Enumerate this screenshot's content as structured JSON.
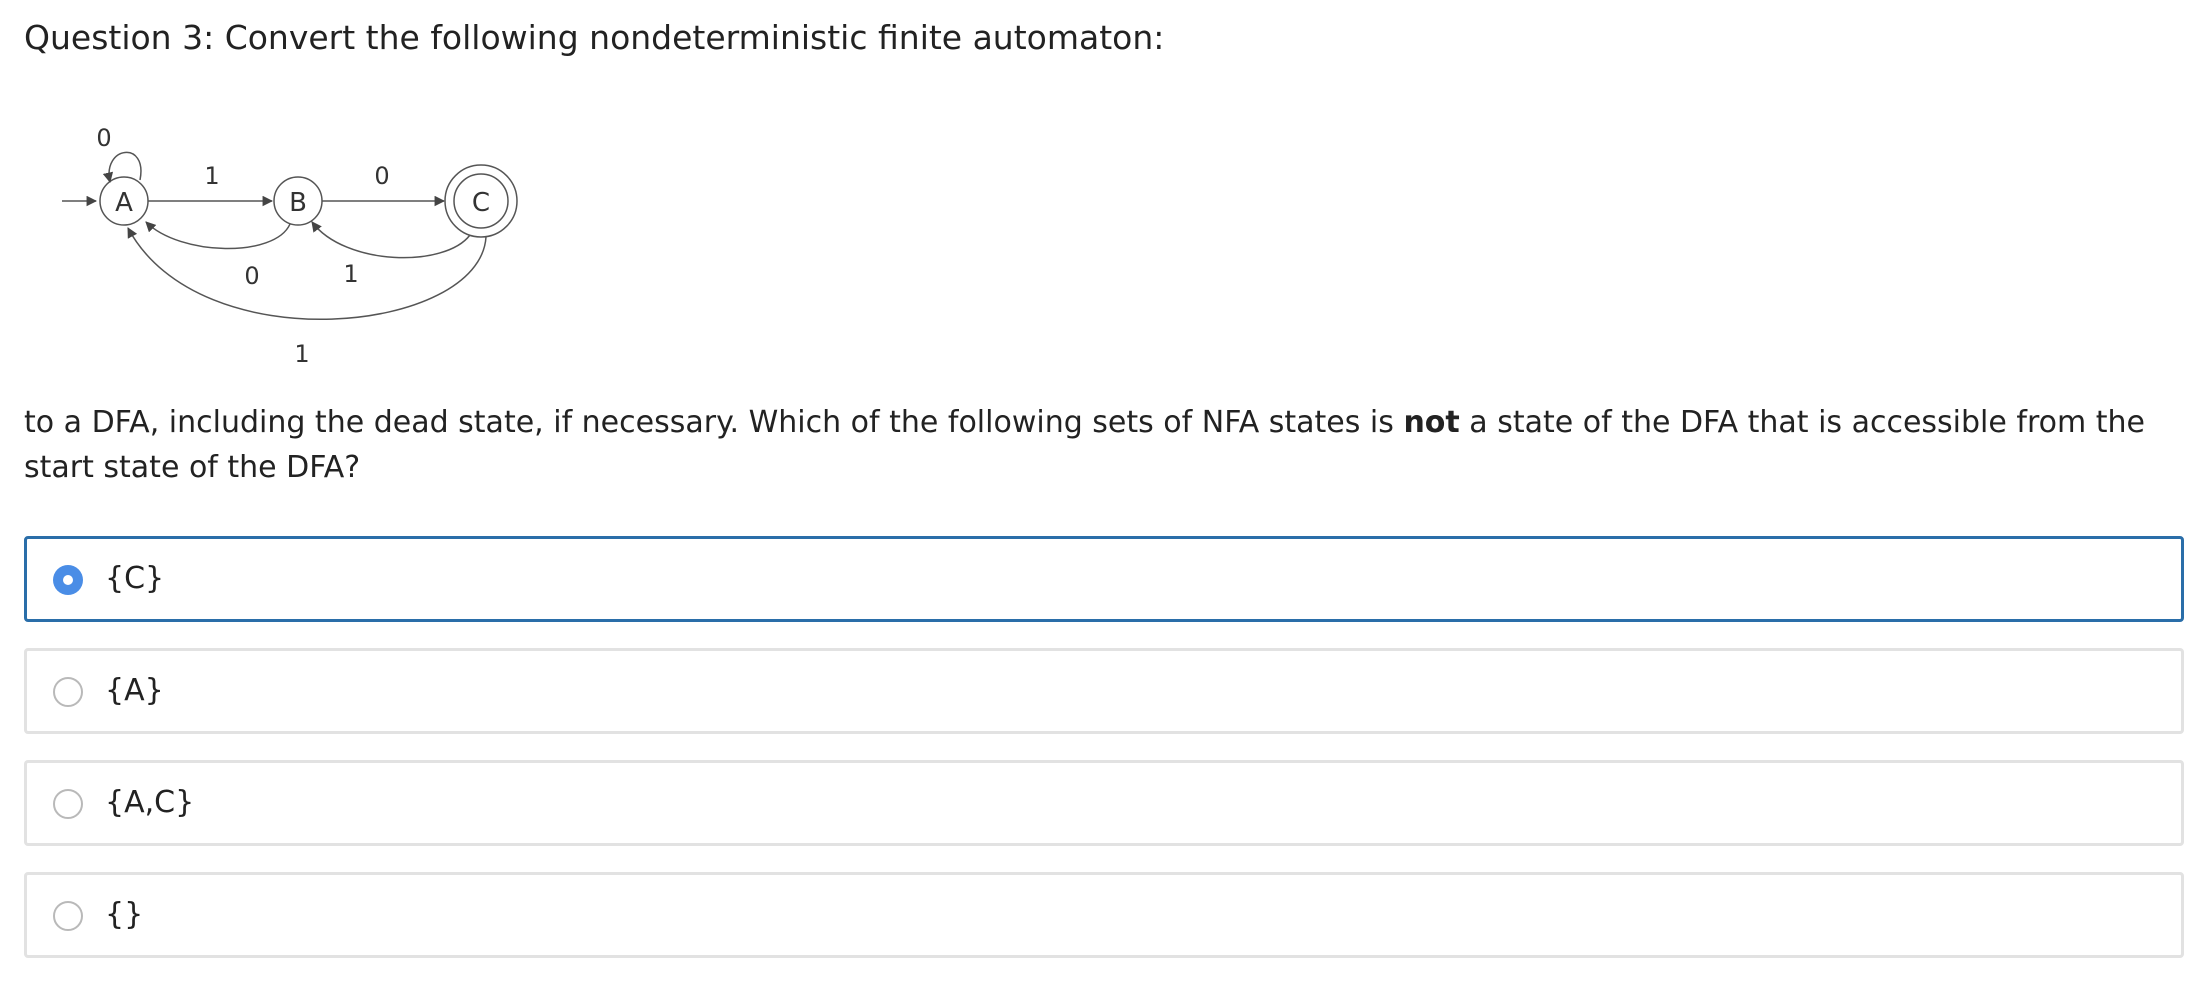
{
  "question": {
    "title": "Question 3: Convert the following nondeterministic finite automaton:",
    "prompt_part1": "to a DFA, including the dead state, if necessary. Which of the following sets of NFA states is ",
    "prompt_bold": "not",
    "prompt_part2": " a state of the DFA that is accessible from the start state of the DFA?"
  },
  "diagram": {
    "states": [
      "A",
      "B",
      "C"
    ],
    "start_state": "A",
    "accepting_states": [
      "C"
    ],
    "transition_labels": {
      "A_self": "0",
      "A_to_B": "1",
      "B_to_C": "0",
      "B_to_A": "0",
      "C_to_B": "1",
      "C_to_A": "1"
    }
  },
  "options": [
    {
      "label": "{C}",
      "selected": true
    },
    {
      "label": "{A}",
      "selected": false
    },
    {
      "label": "{A,C}",
      "selected": false
    },
    {
      "label": "{}",
      "selected": false
    }
  ],
  "colors": {
    "selected_border": "#2a6ea9",
    "radio_checked": "#4a8de6",
    "option_border": "#e2e2e2"
  }
}
